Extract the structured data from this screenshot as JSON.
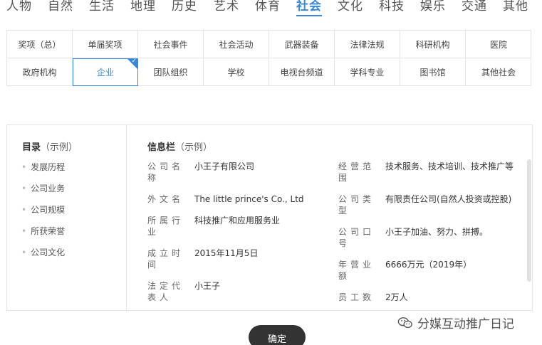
{
  "top_nav": {
    "tabs": [
      "人物",
      "自然",
      "生活",
      "地理",
      "历史",
      "艺术",
      "体育",
      "社会",
      "文化",
      "科技",
      "娱乐",
      "交通",
      "其他"
    ],
    "active": "社会"
  },
  "categories": {
    "row1": [
      "奖项（总）",
      "单届奖项",
      "社会事件",
      "社会活动",
      "武器装备",
      "法律法规",
      "科研机构",
      "医院"
    ],
    "row2": [
      "政府机构",
      "企业",
      "团队组织",
      "学校",
      "电视台频道",
      "学科专业",
      "图书馆",
      "其他社会"
    ],
    "selected": "企业",
    "accent": "#3b87d6"
  },
  "toc": {
    "title": "目录",
    "title_note": "（示例）",
    "items": [
      "发展历程",
      "公司业务",
      "公司规模",
      "所获荣誉",
      "公司文化"
    ]
  },
  "infobox": {
    "title": "信息栏",
    "title_note": "（示例）",
    "left": [
      {
        "label": "公司名称",
        "value": "小王子有限公司"
      },
      {
        "label": "外文名",
        "value": "The little prince's Co., Ltd"
      },
      {
        "label": "所属行业",
        "value": "科技推广和应用服务业"
      },
      {
        "label": "成立时间",
        "value": "2015年11月5日"
      },
      {
        "label": "法定代表人",
        "value": "小王子"
      }
    ],
    "right": [
      {
        "label": "经营范围",
        "value": "技术服务、技术培训、技术推广等"
      },
      {
        "label": "公司类型",
        "value": "有限责任公司(自然人投资或控股)"
      },
      {
        "label": "公司口号",
        "value": "小王子加油、努力、拼搏。"
      },
      {
        "label": "年营业额",
        "value": "6666万元（2019年）"
      },
      {
        "label": "员工数",
        "value": "2万人"
      }
    ]
  },
  "confirm_label": "确定",
  "watermark": {
    "text": "分媒互动推广日记",
    "icon": "wechat-icon"
  }
}
